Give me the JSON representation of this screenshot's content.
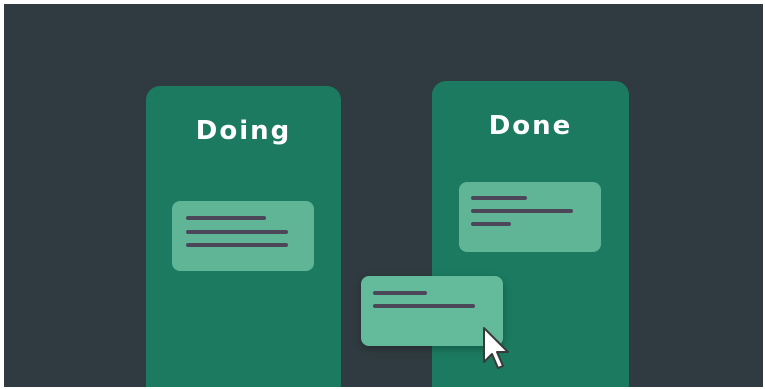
{
  "board": {
    "columns": [
      {
        "title": "Doing"
      },
      {
        "title": "Done"
      }
    ]
  },
  "cards": {
    "doing_card": {
      "lines": 3
    },
    "done_card": {
      "lines": 3
    },
    "dragged_card": {
      "lines": 2
    }
  },
  "cursor": {
    "icon": "arrow-pointer-icon"
  },
  "colors": {
    "background": "#2f3b40",
    "column": "#1b7a5f",
    "card": "#5fb596",
    "card_lines": "#4b4759",
    "title_text": "#ffffff"
  }
}
